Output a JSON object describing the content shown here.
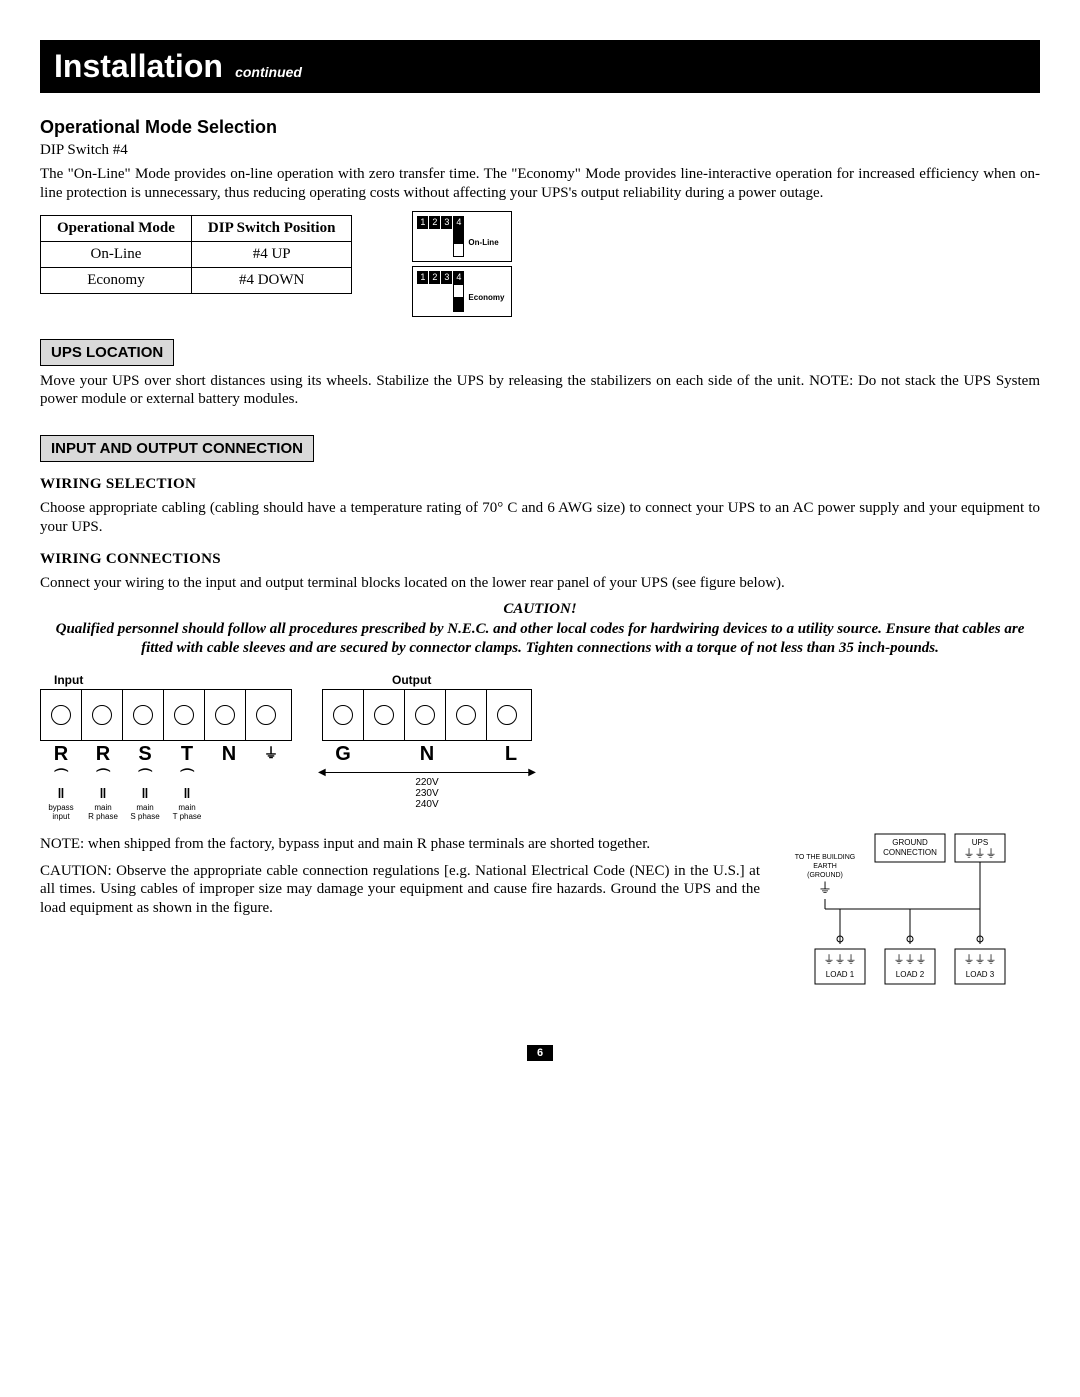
{
  "header": {
    "title": "Installation",
    "subtitle": "continued"
  },
  "opmode": {
    "heading": "Operational Mode Selection",
    "sub": "DIP Switch #4",
    "para": "The \"On-Line\" Mode provides on-line operation with zero transfer time. The \"Economy\" Mode provides line-interactive operation for increased efficiency when on-line protection is unnecessary, thus reducing operating costs without affecting your UPS's output reliability during a power outage.",
    "table": {
      "h1": "Operational Mode",
      "h2": "DIP Switch Position",
      "r1c1": "On-Line",
      "r1c2": "#4 UP",
      "r2c1": "Economy",
      "r2c2": "#4 DOWN"
    },
    "dip": {
      "n1": "1",
      "n2": "2",
      "n3": "3",
      "n4": "4",
      "label_online": "On-Line",
      "label_econ": "Economy"
    }
  },
  "upsloc": {
    "heading": "UPS LOCATION",
    "para": "Move your UPS over short distances using its wheels. Stabilize the UPS by releasing the stabilizers on each side of the unit. NOTE: Do not stack the UPS System power module or external battery modules."
  },
  "io": {
    "heading": "INPUT AND OUTPUT CONNECTION",
    "wiring_sel_h": "WIRING SELECTION",
    "wiring_sel_p": "Choose appropriate cabling (cabling should have a temperature rating of 70° C and 6 AWG size) to connect your UPS to an AC power supply and your equipment to your UPS.",
    "wiring_conn_h": "WIRING CONNECTIONS",
    "wiring_conn_p": "Connect your wiring to the input and output terminal blocks located on the lower rear panel of your UPS (see figure below).",
    "caution_h": "CAUTION!",
    "caution_p": "Qualified personnel should follow all procedures prescribed by N.E.C. and other local codes for hardwiring devices to a utility source. Ensure that cables are fitted with cable sleeves and are secured by connector clamps. Tighten connections with a torque of not less than 35 inch-pounds."
  },
  "terminals": {
    "input_label": "Input",
    "output_label": "Output",
    "in_letters": {
      "a": "R",
      "b": "R",
      "c": "S",
      "d": "T",
      "e": "N",
      "f": "⏚"
    },
    "in_sub": {
      "a": "bypass\ninput",
      "b": "main\nR phase",
      "c": "main\nS phase",
      "d": "main\nT phase"
    },
    "out_letters": {
      "a": "G",
      "b": "N",
      "c": "L"
    },
    "volts": {
      "v1": "220V",
      "v2": "230V",
      "v3": "240V"
    }
  },
  "notes": {
    "n1": "NOTE: when shipped from the factory, bypass input and main R phase terminals are shorted together.",
    "n2": "CAUTION: Observe the appropriate cable connection regulations [e.g. National Electrical Code (NEC) in the U.S.] at all times. Using cables of improper size may damage your equipment and cause fire hazards. Ground the UPS and the load equipment as shown in the figure."
  },
  "ground_diag": {
    "ground_conn": "GROUND\nCONNECTION",
    "ups": "UPS",
    "to_earth": "TO THE BUILDING\nEARTH\n(GROUND)",
    "l1": "LOAD 1",
    "l2": "LOAD 2",
    "l3": "LOAD 3"
  },
  "page": "6"
}
